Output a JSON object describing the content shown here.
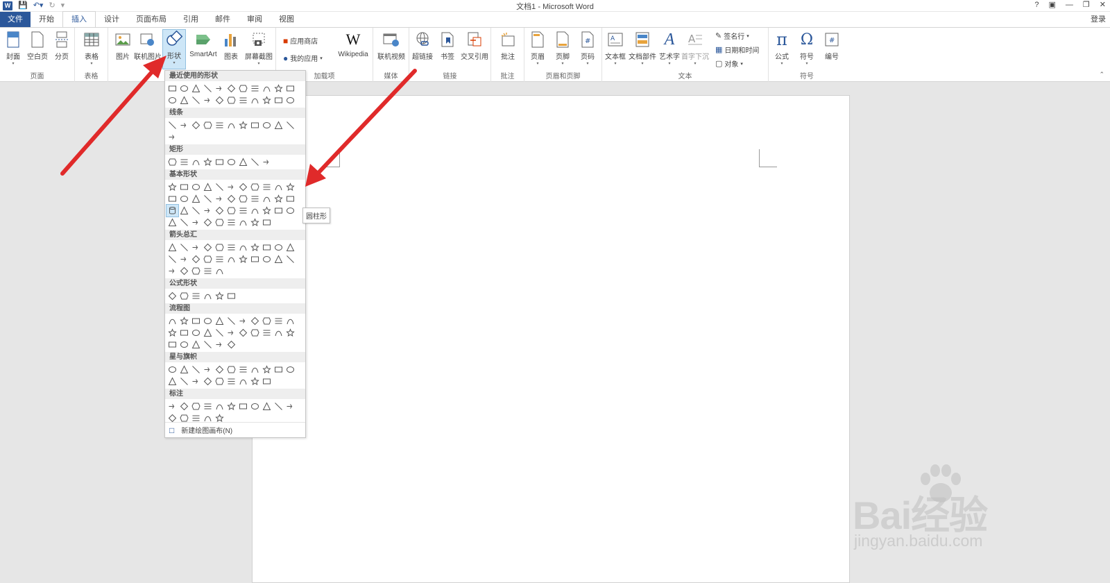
{
  "window": {
    "title": "文档1 - Microsoft Word",
    "help": "?",
    "login": "登录"
  },
  "tabs": [
    {
      "label": "文件"
    },
    {
      "label": "开始"
    },
    {
      "label": "插入"
    },
    {
      "label": "设计"
    },
    {
      "label": "页面布局"
    },
    {
      "label": "引用"
    },
    {
      "label": "邮件"
    },
    {
      "label": "审阅"
    },
    {
      "label": "视图"
    }
  ],
  "ribbon": {
    "groups": {
      "pages": "页面",
      "tables": "表格",
      "addins": "加载项",
      "media": "媒体",
      "links": "链接",
      "comments": "批注",
      "header_footer": "页眉和页脚",
      "text": "文本",
      "symbols": "符号"
    },
    "buttons": {
      "cover": "封面",
      "blank": "空白页",
      "break": "分页",
      "table": "表格",
      "picture": "图片",
      "online_picture": "联机图片",
      "shapes": "形状",
      "smartart": "SmartArt",
      "chart": "图表",
      "screenshot": "屏幕截图",
      "store": "应用商店",
      "my_apps": "我的应用",
      "wikipedia": "Wikipedia",
      "online_video": "联机视频",
      "hyperlink": "超链接",
      "bookmark": "书签",
      "cross_ref": "交叉引用",
      "comment": "批注",
      "header": "页眉",
      "footer": "页脚",
      "page_number": "页码",
      "textbox": "文本框",
      "quick_parts": "文档部件",
      "wordart": "艺术字",
      "dropcap": "首字下沉",
      "signature": "签名行",
      "datetime": "日期和时间",
      "object": "对象",
      "equation": "公式",
      "symbol": "符号",
      "numbering": "编号"
    }
  },
  "shapes_panel": {
    "sections": [
      {
        "title": "最近使用的形状",
        "count": 22
      },
      {
        "title": "线条",
        "count": 12
      },
      {
        "title": "矩形",
        "count": 9
      },
      {
        "title": "基本形状",
        "count": 42
      },
      {
        "title": "箭头总汇",
        "count": 27
      },
      {
        "title": "公式形状",
        "count": 6
      },
      {
        "title": "流程图",
        "count": 28
      },
      {
        "title": "星与旗帜",
        "count": 20
      },
      {
        "title": "标注",
        "count": 16
      }
    ],
    "new_canvas": "新建绘图画布(N)"
  },
  "tooltip": "圆柱形",
  "watermark": {
    "brand": "Bai经验",
    "url": "jingyan.baidu.com"
  },
  "colors": {
    "accent": "#2b579a",
    "arrow": "#e02a2a",
    "highlight": "#cde6f7"
  }
}
